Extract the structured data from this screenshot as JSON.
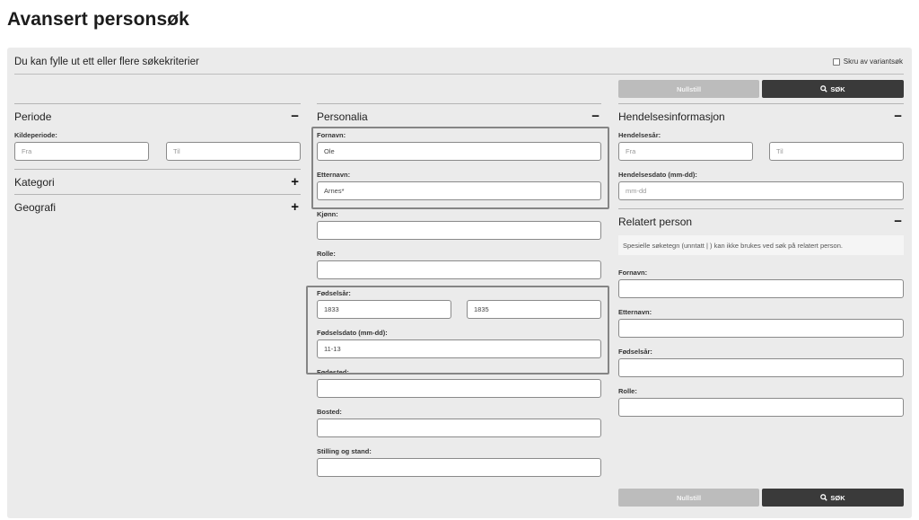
{
  "page": {
    "title": "Avansert personsøk"
  },
  "panel": {
    "intro": "Du kan fylle ut ett eller flere søkekriterier",
    "variant_label": "Skru av variantsøk",
    "reset_label": "Nullstill",
    "search_label": "SØK"
  },
  "left": {
    "periode": {
      "title": "Periode",
      "toggle": "−",
      "label": "Kildeperiode:",
      "from_placeholder": "Fra",
      "to_placeholder": "Til"
    },
    "kategori": {
      "title": "Kategori",
      "toggle": "+"
    },
    "geografi": {
      "title": "Geografi",
      "toggle": "+"
    }
  },
  "middle": {
    "title": "Personalia",
    "toggle": "−",
    "fornavn": {
      "label": "Fornavn:",
      "value": "Ole"
    },
    "etternavn": {
      "label": "Etternavn:",
      "value": "Arnes*"
    },
    "kjonn": {
      "label": "Kjønn:",
      "value": ""
    },
    "rolle": {
      "label": "Rolle:",
      "value": ""
    },
    "fodselsar": {
      "label": "Fødselsår:",
      "from": "1833",
      "to": "1835"
    },
    "fodselsdato": {
      "label": "Fødselsdato (mm-dd):",
      "value": "11-13"
    },
    "fodested": {
      "label": "Fødested:",
      "value": ""
    },
    "bosted": {
      "label": "Bosted:",
      "value": ""
    },
    "stilling": {
      "label": "Stilling og stand:",
      "value": ""
    }
  },
  "right": {
    "hendelse": {
      "title": "Hendelsesinformasjon",
      "toggle": "−",
      "year_label": "Hendelsesår:",
      "from_placeholder": "Fra",
      "to_placeholder": "Til",
      "date_label": "Hendelsesdato (mm-dd):",
      "date_placeholder": "mm-dd"
    },
    "relatert": {
      "title": "Relatert person",
      "toggle": "−",
      "hint": "Spesielle søketegn (unntatt | ) kan ikke brukes ved søk på relatert person.",
      "fornavn_label": "Fornavn:",
      "etternavn_label": "Etternavn:",
      "fodselsar_label": "Fødselsår:",
      "rolle_label": "Rolle:"
    }
  }
}
